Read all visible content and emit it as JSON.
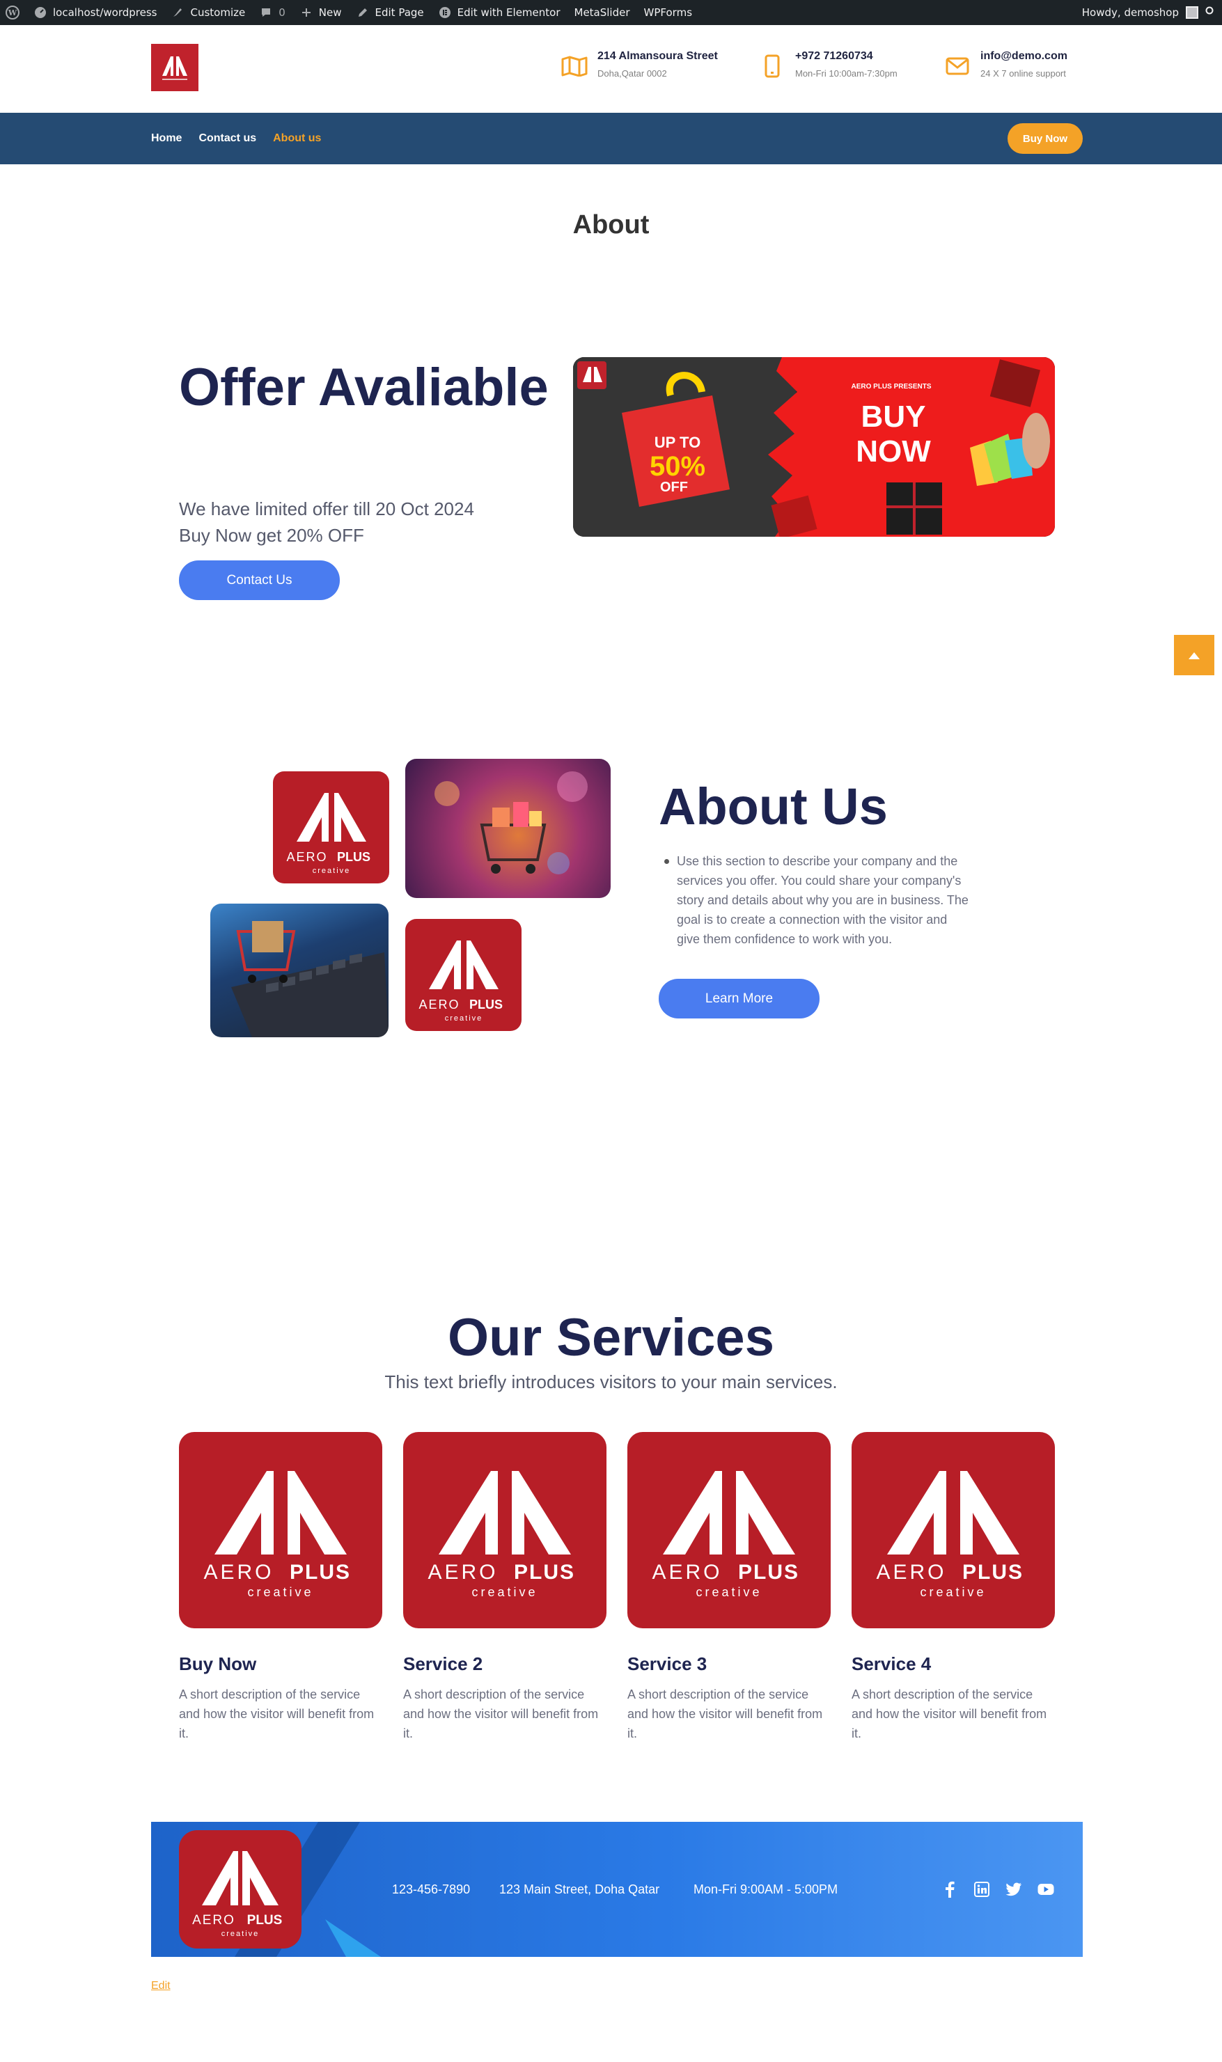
{
  "adminbar": {
    "site": "localhost/wordpress",
    "customize": "Customize",
    "comments": "0",
    "new": "New",
    "edit_page": "Edit Page",
    "elementor": "Edit with Elementor",
    "metaslider": "MetaSlider",
    "wpforms": "WPForms",
    "howdy": "Howdy, demoshop"
  },
  "header": {
    "address_line1": "214 Almansoura Street",
    "address_line2": "Doha,Qatar 0002",
    "phone_line1": "+972 71260734",
    "phone_line2": "Mon-Fri 10:00am-7:30pm",
    "email_line1": "info@demo.com",
    "email_line2": "24 X 7 online support"
  },
  "nav": {
    "items": [
      "Home",
      "Contact us",
      "About us"
    ],
    "active": "About us",
    "buy_now": "Buy Now"
  },
  "page_title": "About",
  "offer": {
    "title": "Offer Avaliable",
    "line1": "We have limited offer till 20 Oct 2024",
    "line2": "Buy Now get 20% OFF",
    "button": "Contact Us"
  },
  "banner": {
    "up_to": "UP TO",
    "percent": "50%",
    "off": "OFF",
    "presents": "AERO PLUS PRESENTS",
    "buy": "BUY",
    "now": "NOW"
  },
  "logo": {
    "aero": "AERO",
    "plus": "PLUS",
    "creative": "creative"
  },
  "about": {
    "title": "About Us",
    "text": "Use this section to describe your company and the services you offer. You could share your company's story and details about why you are in business. The goal is to create a connection with the visitor and give them confidence to work with you.",
    "button": "Learn More"
  },
  "services": {
    "title": "Our Services",
    "subtitle": "This text briefly introduces visitors to your main services.",
    "items": [
      {
        "name": "Buy Now",
        "desc": "A short description of the service and how the visitor will benefit from it."
      },
      {
        "name": "Service 2",
        "desc": "A short description of the service and how the visitor will benefit from it."
      },
      {
        "name": "Service 3",
        "desc": "A short description of the service and how the visitor will benefit from it."
      },
      {
        "name": "Service 4",
        "desc": "A short description of the service and how the visitor will benefit from it."
      }
    ]
  },
  "footer": {
    "phone": "123-456-7890",
    "address": "123 Main Street, Doha Qatar",
    "hours": "Mon-Fri 9:00AM - 5:00PM",
    "social": [
      "facebook-icon",
      "linkedin-icon",
      "twitter-icon",
      "youtube-icon"
    ]
  },
  "edit_link": "Edit",
  "colors": {
    "nav_bg": "#254b73",
    "accent_orange": "#f4a227",
    "brand_red": "#b71e27",
    "button_blue": "#4a7cf0",
    "heading_navy": "#1e2450"
  }
}
